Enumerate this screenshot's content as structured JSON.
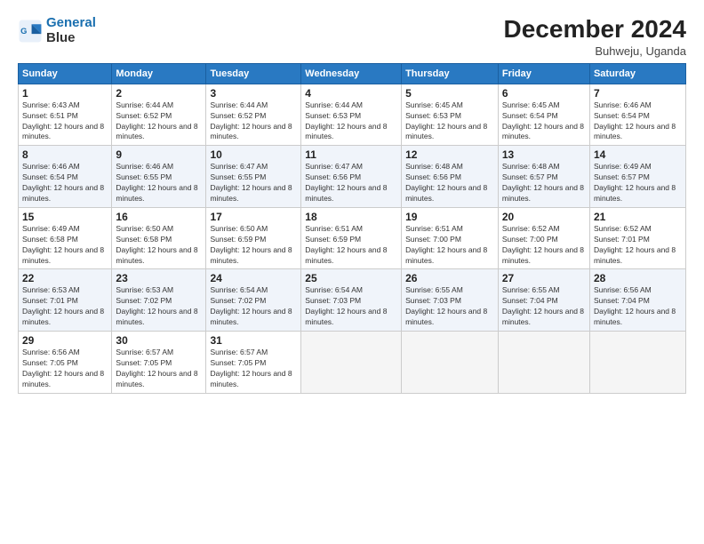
{
  "logo": {
    "line1": "General",
    "line2": "Blue"
  },
  "title": "December 2024",
  "location": "Buhweju, Uganda",
  "weekdays": [
    "Sunday",
    "Monday",
    "Tuesday",
    "Wednesday",
    "Thursday",
    "Friday",
    "Saturday"
  ],
  "weeks": [
    [
      {
        "day": "1",
        "sunrise": "6:43 AM",
        "sunset": "6:51 PM",
        "daylight": "12 hours and 8 minutes."
      },
      {
        "day": "2",
        "sunrise": "6:44 AM",
        "sunset": "6:52 PM",
        "daylight": "12 hours and 8 minutes."
      },
      {
        "day": "3",
        "sunrise": "6:44 AM",
        "sunset": "6:52 PM",
        "daylight": "12 hours and 8 minutes."
      },
      {
        "day": "4",
        "sunrise": "6:44 AM",
        "sunset": "6:53 PM",
        "daylight": "12 hours and 8 minutes."
      },
      {
        "day": "5",
        "sunrise": "6:45 AM",
        "sunset": "6:53 PM",
        "daylight": "12 hours and 8 minutes."
      },
      {
        "day": "6",
        "sunrise": "6:45 AM",
        "sunset": "6:54 PM",
        "daylight": "12 hours and 8 minutes."
      },
      {
        "day": "7",
        "sunrise": "6:46 AM",
        "sunset": "6:54 PM",
        "daylight": "12 hours and 8 minutes."
      }
    ],
    [
      {
        "day": "8",
        "sunrise": "6:46 AM",
        "sunset": "6:54 PM",
        "daylight": "12 hours and 8 minutes."
      },
      {
        "day": "9",
        "sunrise": "6:46 AM",
        "sunset": "6:55 PM",
        "daylight": "12 hours and 8 minutes."
      },
      {
        "day": "10",
        "sunrise": "6:47 AM",
        "sunset": "6:55 PM",
        "daylight": "12 hours and 8 minutes."
      },
      {
        "day": "11",
        "sunrise": "6:47 AM",
        "sunset": "6:56 PM",
        "daylight": "12 hours and 8 minutes."
      },
      {
        "day": "12",
        "sunrise": "6:48 AM",
        "sunset": "6:56 PM",
        "daylight": "12 hours and 8 minutes."
      },
      {
        "day": "13",
        "sunrise": "6:48 AM",
        "sunset": "6:57 PM",
        "daylight": "12 hours and 8 minutes."
      },
      {
        "day": "14",
        "sunrise": "6:49 AM",
        "sunset": "6:57 PM",
        "daylight": "12 hours and 8 minutes."
      }
    ],
    [
      {
        "day": "15",
        "sunrise": "6:49 AM",
        "sunset": "6:58 PM",
        "daylight": "12 hours and 8 minutes."
      },
      {
        "day": "16",
        "sunrise": "6:50 AM",
        "sunset": "6:58 PM",
        "daylight": "12 hours and 8 minutes."
      },
      {
        "day": "17",
        "sunrise": "6:50 AM",
        "sunset": "6:59 PM",
        "daylight": "12 hours and 8 minutes."
      },
      {
        "day": "18",
        "sunrise": "6:51 AM",
        "sunset": "6:59 PM",
        "daylight": "12 hours and 8 minutes."
      },
      {
        "day": "19",
        "sunrise": "6:51 AM",
        "sunset": "7:00 PM",
        "daylight": "12 hours and 8 minutes."
      },
      {
        "day": "20",
        "sunrise": "6:52 AM",
        "sunset": "7:00 PM",
        "daylight": "12 hours and 8 minutes."
      },
      {
        "day": "21",
        "sunrise": "6:52 AM",
        "sunset": "7:01 PM",
        "daylight": "12 hours and 8 minutes."
      }
    ],
    [
      {
        "day": "22",
        "sunrise": "6:53 AM",
        "sunset": "7:01 PM",
        "daylight": "12 hours and 8 minutes."
      },
      {
        "day": "23",
        "sunrise": "6:53 AM",
        "sunset": "7:02 PM",
        "daylight": "12 hours and 8 minutes."
      },
      {
        "day": "24",
        "sunrise": "6:54 AM",
        "sunset": "7:02 PM",
        "daylight": "12 hours and 8 minutes."
      },
      {
        "day": "25",
        "sunrise": "6:54 AM",
        "sunset": "7:03 PM",
        "daylight": "12 hours and 8 minutes."
      },
      {
        "day": "26",
        "sunrise": "6:55 AM",
        "sunset": "7:03 PM",
        "daylight": "12 hours and 8 minutes."
      },
      {
        "day": "27",
        "sunrise": "6:55 AM",
        "sunset": "7:04 PM",
        "daylight": "12 hours and 8 minutes."
      },
      {
        "day": "28",
        "sunrise": "6:56 AM",
        "sunset": "7:04 PM",
        "daylight": "12 hours and 8 minutes."
      }
    ],
    [
      {
        "day": "29",
        "sunrise": "6:56 AM",
        "sunset": "7:05 PM",
        "daylight": "12 hours and 8 minutes."
      },
      {
        "day": "30",
        "sunrise": "6:57 AM",
        "sunset": "7:05 PM",
        "daylight": "12 hours and 8 minutes."
      },
      {
        "day": "31",
        "sunrise": "6:57 AM",
        "sunset": "7:05 PM",
        "daylight": "12 hours and 8 minutes."
      },
      null,
      null,
      null,
      null
    ]
  ]
}
